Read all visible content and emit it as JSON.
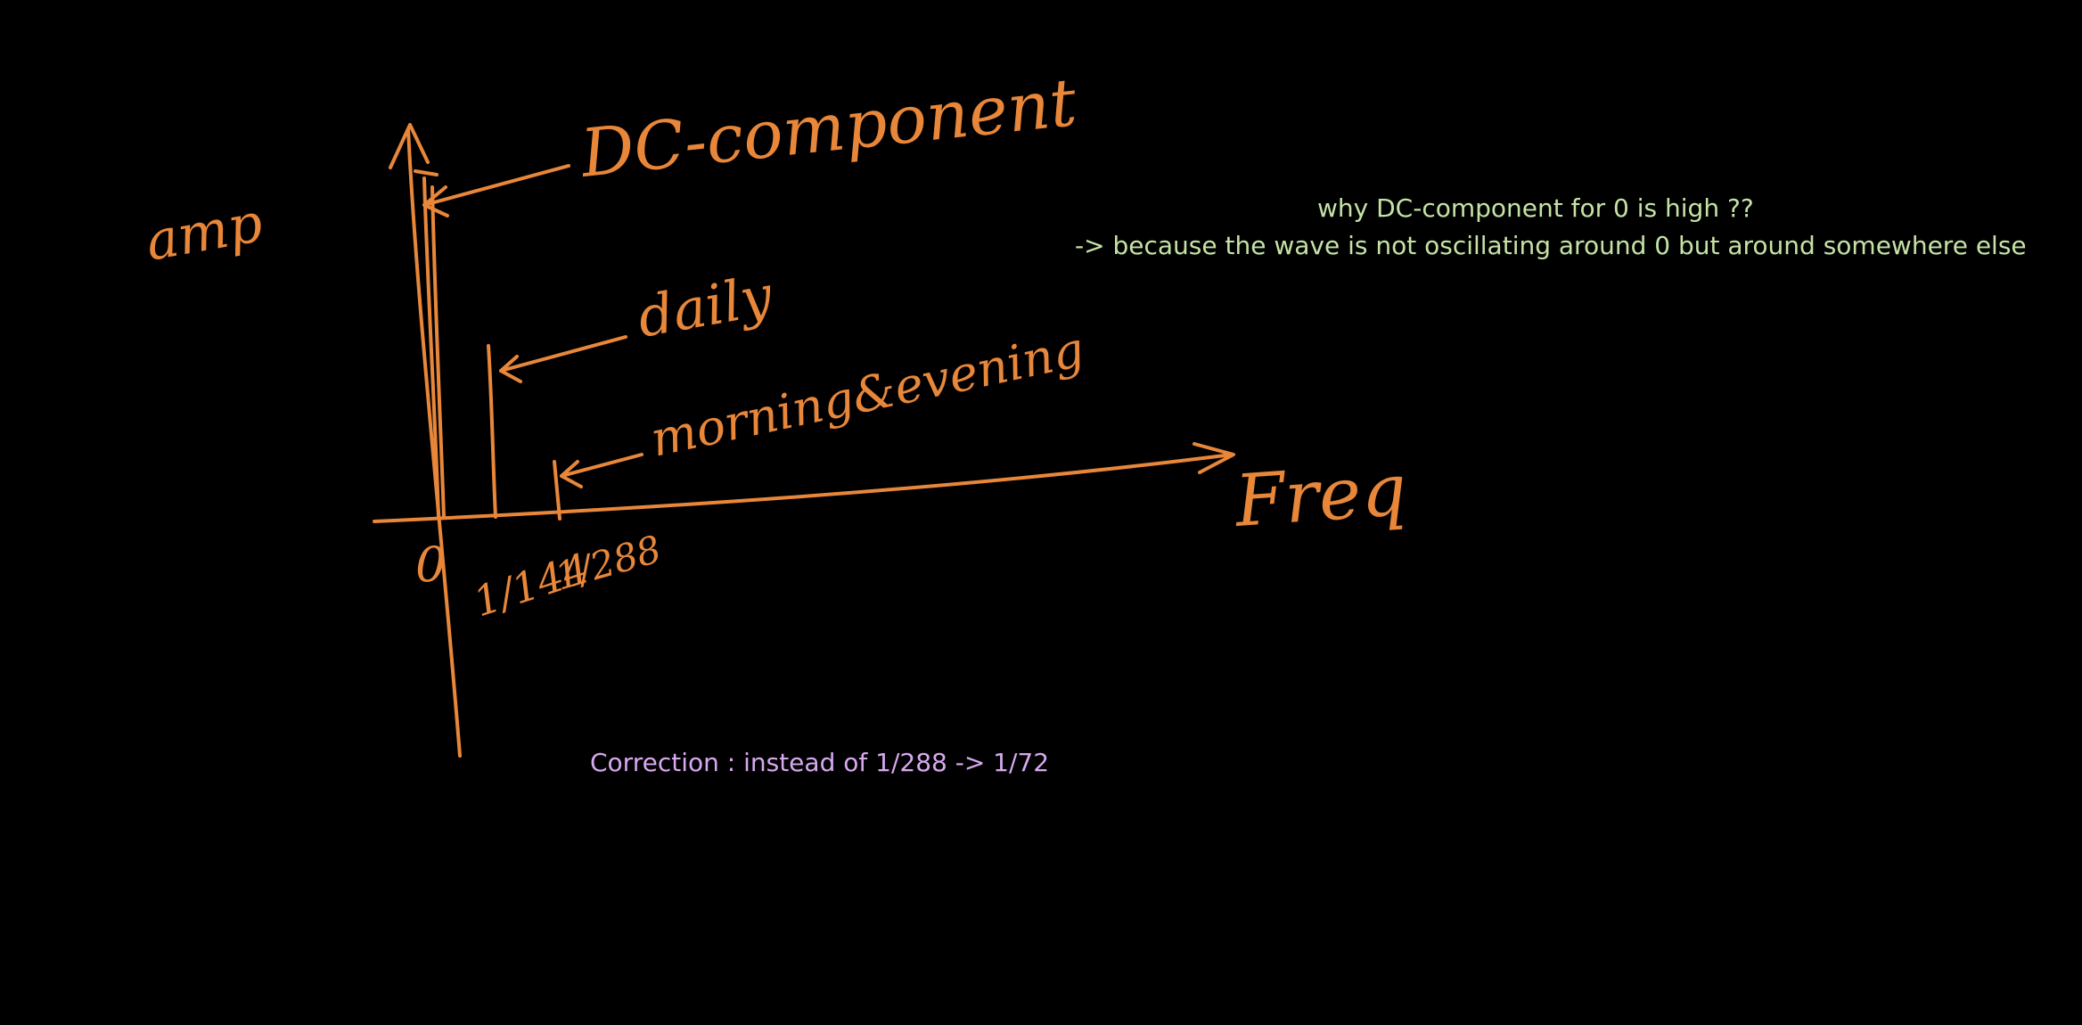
{
  "colors": {
    "background": "#000000",
    "ink": "#E8873A",
    "note": "#C5E3A5",
    "correction": "#D8A8F0"
  },
  "diagram": {
    "y_axis_label": "amp",
    "x_axis_label": "Freq",
    "origin_label": "0",
    "labels": {
      "dc": "DC-component",
      "daily": "daily",
      "morning_evening": "morning&evening"
    },
    "ticks": {
      "t1": "1/144",
      "t2": "1/288"
    }
  },
  "notes": {
    "question": "why DC-component for 0 is high ??",
    "answer": "-> because the wave is not oscillating around 0 but around somewhere else",
    "correction": "Correction : instead of 1/288 -> 1/72"
  }
}
